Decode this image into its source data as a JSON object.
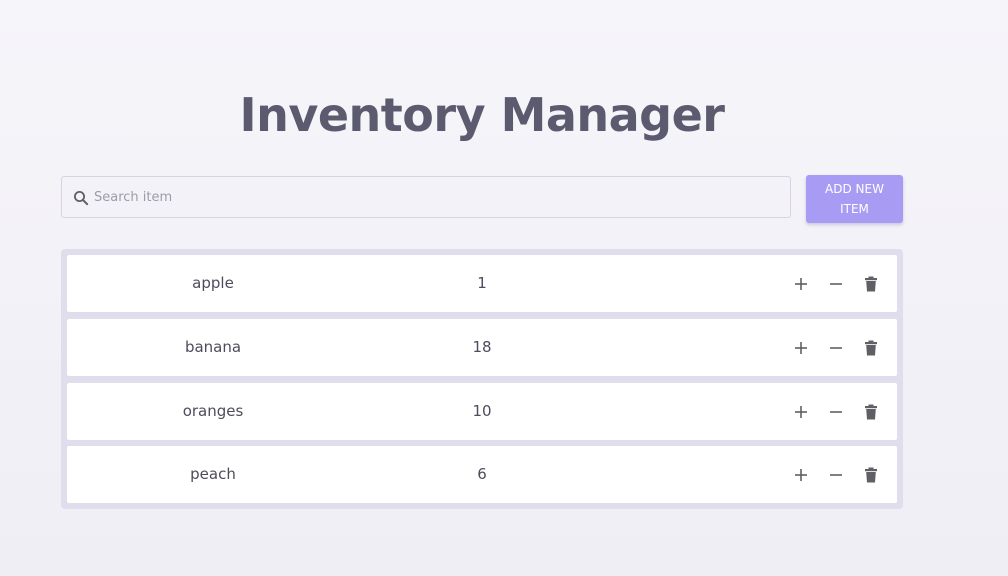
{
  "header": {
    "title": "Inventory Manager"
  },
  "search": {
    "placeholder": "Search item",
    "value": "",
    "icon": "search-icon"
  },
  "actions": {
    "add_label": "ADD NEW ITEM"
  },
  "inventory": {
    "items": [
      {
        "name": "apple",
        "quantity": "1"
      },
      {
        "name": "banana",
        "quantity": "18"
      },
      {
        "name": "oranges",
        "quantity": "10"
      },
      {
        "name": "peach",
        "quantity": "6"
      }
    ],
    "row_icons": [
      "plus-icon",
      "minus-icon",
      "trash-icon"
    ]
  },
  "colors": {
    "accent": "#a89bf4",
    "title": "#5c5a6e",
    "panel": "#e0deec",
    "icon": "#5f5f66"
  }
}
